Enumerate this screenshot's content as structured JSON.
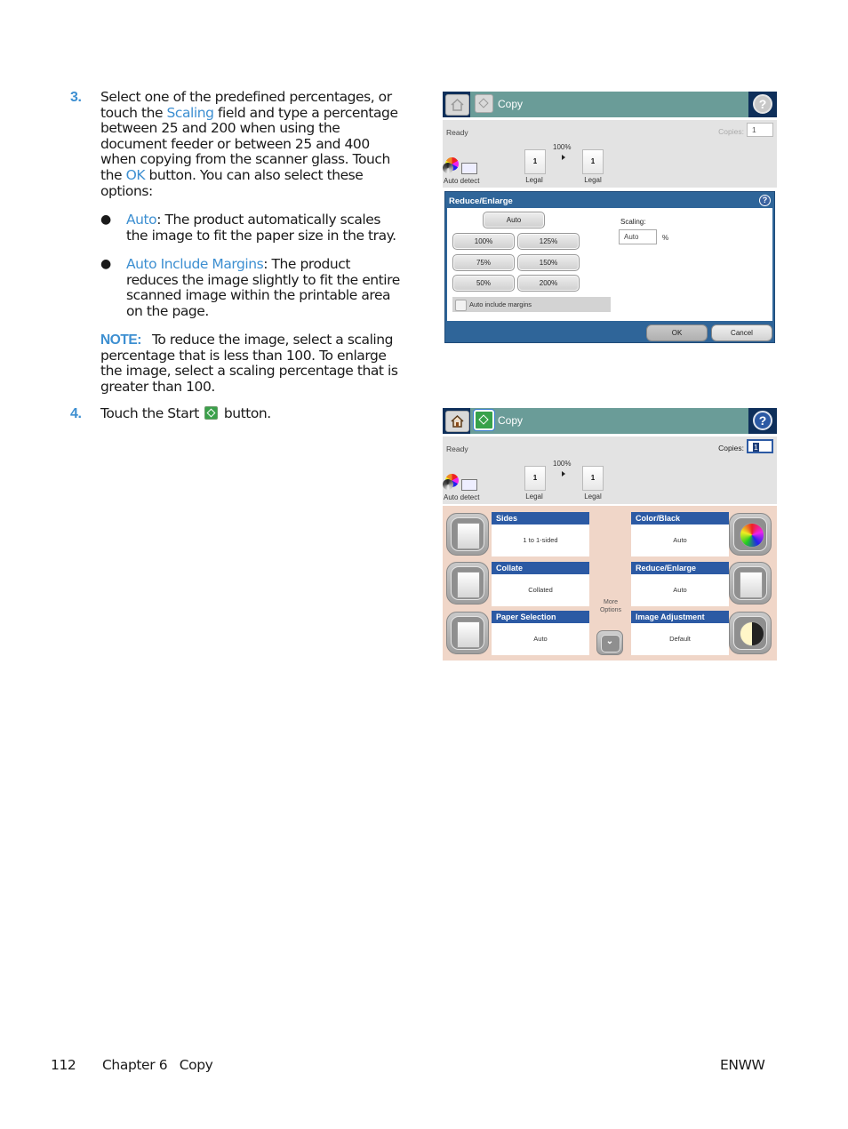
{
  "instructions": {
    "step3": {
      "number": "3.",
      "text_parts": [
        "Select one of the predefined percentages, or touch the ",
        "Scaling",
        " field and type a percentage between 25 and 200 when using the document feeder or between 25 and 400 when copying from the scanner glass. Touch the ",
        "OK",
        " button. You can also select these options:"
      ],
      "bullets": [
        {
          "term": "Auto",
          "text": ": The product automatically scales the image to fit the paper size in the tray."
        },
        {
          "term": "Auto Include Margins",
          "text": ": The product reduces the image slightly to fit the entire scanned image within the printable area on the page."
        }
      ],
      "note_label": "NOTE:",
      "note_text": "To reduce the image, select a scaling percentage that is less than 100. To enlarge the image, select a scaling percentage that is greater than 100."
    },
    "step4": {
      "number": "4.",
      "text_before": "Touch the Start ",
      "text_after": " button.",
      "icon": "start-icon"
    }
  },
  "screen1": {
    "title": "Copy",
    "status": "Ready",
    "copies_label": "Copies:",
    "copies_value": "1",
    "auto_detect": "Auto detect",
    "scale_percent": "100%",
    "original": {
      "count": "1",
      "size": "Legal"
    },
    "output": {
      "count": "1",
      "size": "Legal"
    },
    "dialog": {
      "title": "Reduce/Enlarge",
      "help": "?",
      "auto_button": "Auto",
      "presets": [
        "100%",
        "125%",
        "75%",
        "150%",
        "50%",
        "200%"
      ],
      "checkbox_label": "Auto include margins",
      "checkbox_checked": false,
      "scaling_label": "Scaling:",
      "scaling_value": "Auto",
      "scaling_unit": "%",
      "ok": "OK",
      "cancel": "Cancel"
    }
  },
  "screen2": {
    "title": "Copy",
    "status": "Ready",
    "copies_label": "Copies:",
    "copies_value": "1",
    "auto_detect": "Auto detect",
    "scale_percent": "100%",
    "original": {
      "count": "1",
      "size": "Legal"
    },
    "output": {
      "count": "1",
      "size": "Legal"
    },
    "tiles_left": [
      {
        "title": "Sides",
        "value": "1 to 1-sided",
        "icon": "sides-icon"
      },
      {
        "title": "Collate",
        "value": "Collated",
        "icon": "collate-icon"
      },
      {
        "title": "Paper Selection",
        "value": "Auto",
        "icon": "paper-selection-icon"
      }
    ],
    "tiles_right": [
      {
        "title": "Color/Black",
        "value": "Auto",
        "icon": "color-black-icon"
      },
      {
        "title": "Reduce/Enlarge",
        "value": "Auto",
        "icon": "reduce-enlarge-icon"
      },
      {
        "title": "Image Adjustment",
        "value": "Default",
        "icon": "image-adjustment-icon"
      }
    ],
    "more_options": "More Options"
  },
  "footer": {
    "page_number": "112",
    "chapter": "Chapter 6   Copy",
    "right": "ENWW"
  },
  "colors": {
    "accent_blue": "#3d8fd1",
    "title_bar_teal": "#6a9c98",
    "dialog_blue": "#2f6599",
    "tile_header_blue": "#2c5aa4",
    "tiles_bg": "#f0d6c8",
    "start_green": "#37a24a"
  }
}
